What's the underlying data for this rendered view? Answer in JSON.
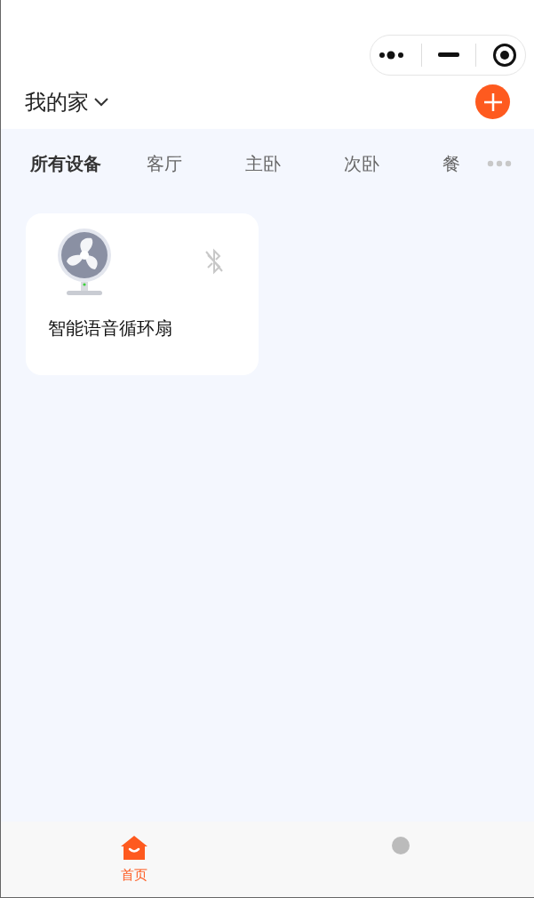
{
  "header": {
    "home_name": "我的家"
  },
  "rooms": [
    {
      "label": "所有设备",
      "selected": true
    },
    {
      "label": "客厅",
      "selected": false
    },
    {
      "label": "主卧",
      "selected": false
    },
    {
      "label": "次卧",
      "selected": false
    },
    {
      "label": "餐",
      "selected": false
    }
  ],
  "devices": [
    {
      "name": "智能语音循环扇",
      "bluetooth_connected": false
    }
  ],
  "tab_bar": [
    {
      "label": "首页",
      "selected": true
    },
    {
      "selected": false
    }
  ]
}
